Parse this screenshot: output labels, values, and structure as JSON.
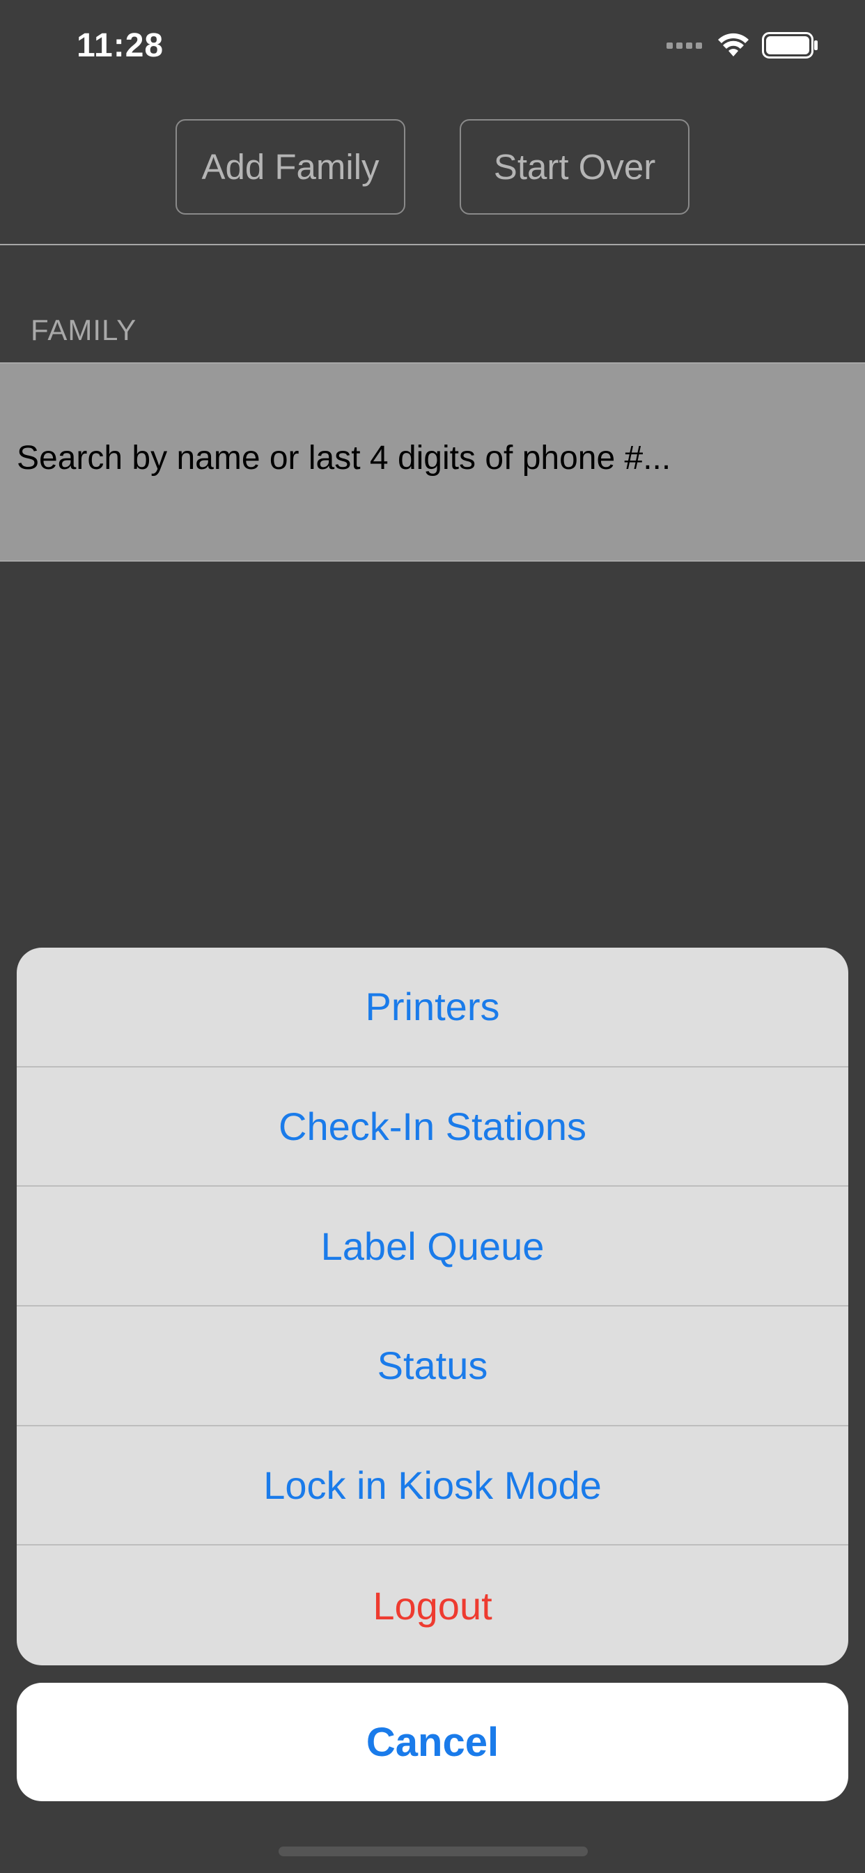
{
  "status_bar": {
    "time": "11:28",
    "icons": [
      "cellular-dots-icon",
      "wifi-icon",
      "battery-icon"
    ]
  },
  "toolbar": {
    "add_family_label": "Add Family",
    "start_over_label": "Start Over"
  },
  "section": {
    "label": "FAMILY"
  },
  "search": {
    "placeholder": "Search by name or last 4 digits of phone #..."
  },
  "action_sheet": {
    "items": [
      {
        "label": "Printers"
      },
      {
        "label": "Check-In Stations"
      },
      {
        "label": "Label Queue"
      },
      {
        "label": "Status"
      },
      {
        "label": "Lock in Kiosk Mode"
      },
      {
        "label": "Logout"
      }
    ],
    "cancel_label": "Cancel"
  },
  "colors": {
    "background": "#3d3d3d",
    "accent": "#1a7bea",
    "destructive": "#ee3b30",
    "sheet": "#dedede",
    "search_band": "#999999"
  }
}
